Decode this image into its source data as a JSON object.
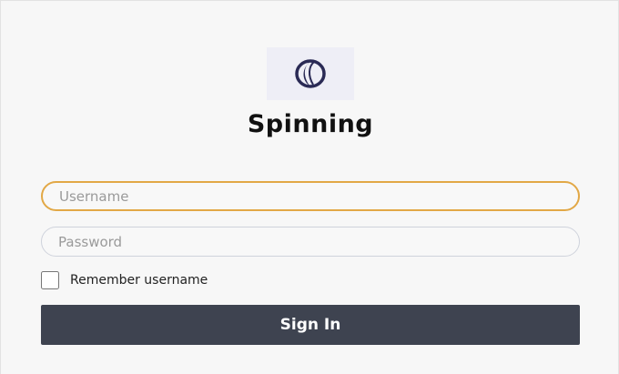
{
  "app": {
    "title": "Spinning",
    "logo_icon": "crescent-swirl-logo"
  },
  "form": {
    "username_placeholder": "Username",
    "username_value": "",
    "password_placeholder": "Password",
    "password_value": "",
    "remember_label": "Remember username",
    "remember_checked": false,
    "submit_label": "Sign In"
  },
  "colors": {
    "focus_border": "#e2a846",
    "button_bg": "#3e4350",
    "logo_mark": "#2a2a55",
    "logo_bg": "#eeeef6"
  }
}
